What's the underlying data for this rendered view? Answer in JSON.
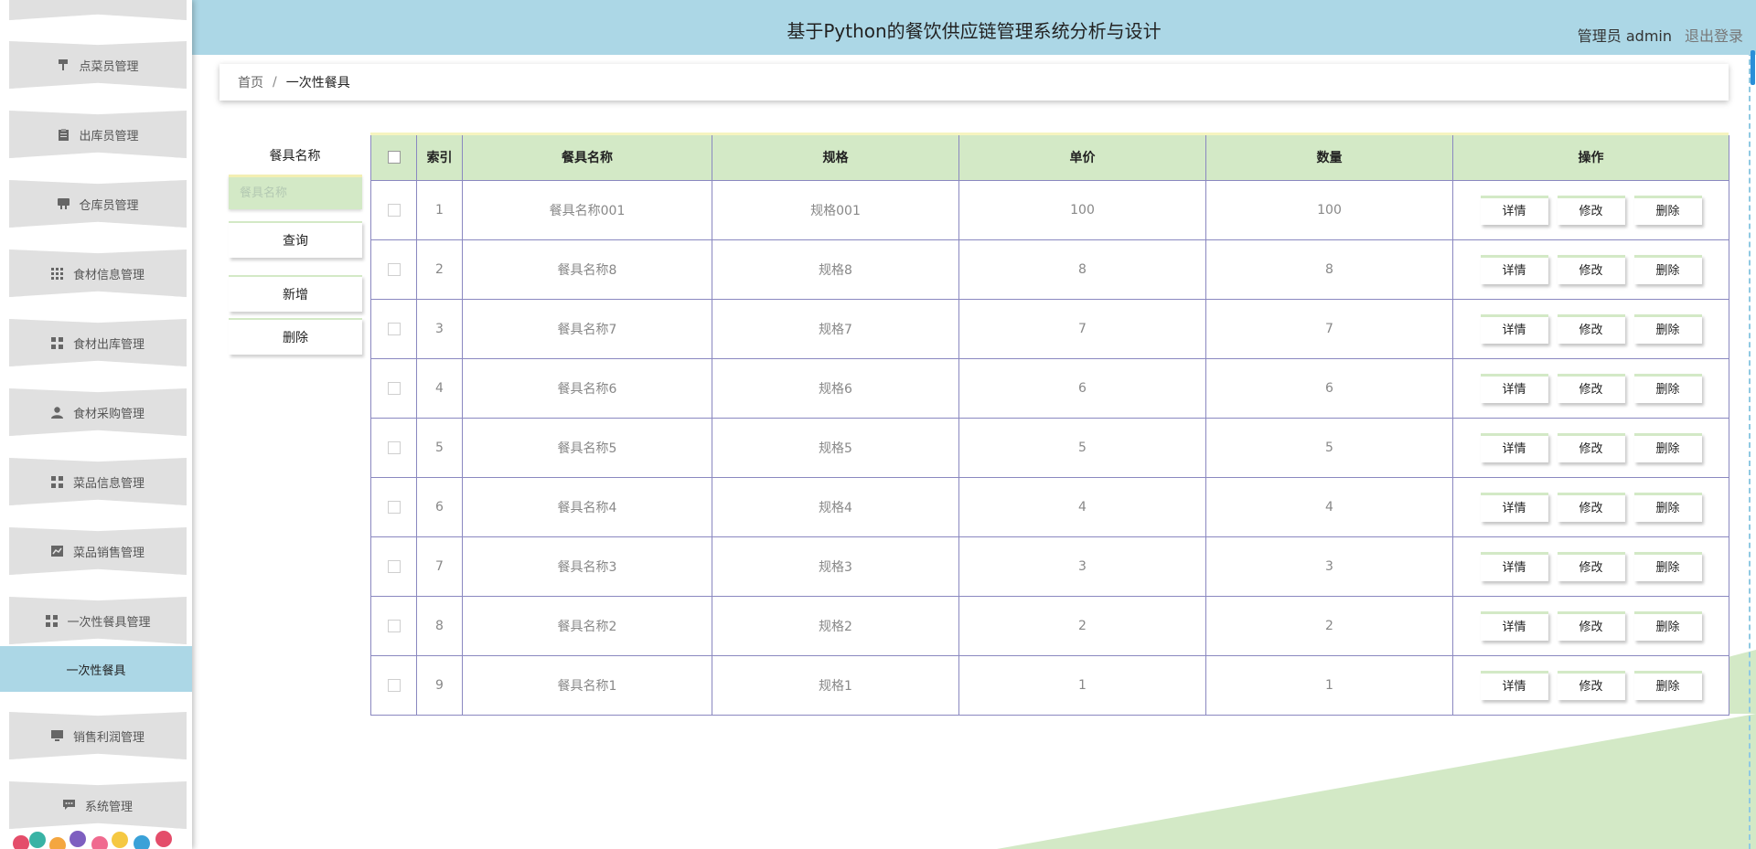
{
  "header": {
    "title": "基于Python的餐饮供应链管理系统分析与设计",
    "user_label": "管理员 admin",
    "logout_label": "退出登录"
  },
  "sidebar": {
    "items": [
      {
        "label": "点菜员管理",
        "icon": "pin-icon"
      },
      {
        "label": "出库员管理",
        "icon": "clipboard-icon"
      },
      {
        "label": "仓库员管理",
        "icon": "desk-icon"
      },
      {
        "label": "食材信息管理",
        "icon": "grid-icon"
      },
      {
        "label": "食材出库管理",
        "icon": "grid-icon"
      },
      {
        "label": "食材采购管理",
        "icon": "user-icon"
      },
      {
        "label": "菜品信息管理",
        "icon": "grid-icon"
      },
      {
        "label": "菜品销售管理",
        "icon": "chart-icon"
      },
      {
        "label": "一次性餐具管理",
        "icon": "grid-icon"
      },
      {
        "label": "销售利润管理",
        "icon": "monitor-icon"
      },
      {
        "label": "系统管理",
        "icon": "chat-icon"
      }
    ],
    "active_item": "一次性餐具"
  },
  "breadcrumb": {
    "home": "首页",
    "separator": "/",
    "current": "一次性餐具"
  },
  "search": {
    "label": "餐具名称",
    "placeholder": "餐具名称",
    "query_label": "查询",
    "add_label": "新增",
    "delete_label": "删除"
  },
  "table": {
    "columns": [
      "索引",
      "餐具名称",
      "规格",
      "单价",
      "数量",
      "操作"
    ],
    "row_actions": {
      "detail": "详情",
      "edit": "修改",
      "delete": "删除"
    },
    "rows": [
      {
        "index": "1",
        "name": "餐具名称001",
        "spec": "规格001",
        "price": "100",
        "qty": "100"
      },
      {
        "index": "2",
        "name": "餐具名称8",
        "spec": "规格8",
        "price": "8",
        "qty": "8"
      },
      {
        "index": "3",
        "name": "餐具名称7",
        "spec": "规格7",
        "price": "7",
        "qty": "7"
      },
      {
        "index": "4",
        "name": "餐具名称6",
        "spec": "规格6",
        "price": "6",
        "qty": "6"
      },
      {
        "index": "5",
        "name": "餐具名称5",
        "spec": "规格5",
        "price": "5",
        "qty": "5"
      },
      {
        "index": "6",
        "name": "餐具名称4",
        "spec": "规格4",
        "price": "4",
        "qty": "4"
      },
      {
        "index": "7",
        "name": "餐具名称3",
        "spec": "规格3",
        "price": "3",
        "qty": "3"
      },
      {
        "index": "8",
        "name": "餐具名称2",
        "spec": "规格2",
        "price": "2",
        "qty": "2"
      },
      {
        "index": "9",
        "name": "餐具名称1",
        "spec": "规格1",
        "price": "1",
        "qty": "1"
      }
    ]
  },
  "colors": {
    "header_bg": "#acd7e6",
    "table_header_bg": "#d3e9c6",
    "border": "#8a88c0",
    "menu_bg": "#e0e0e0"
  }
}
